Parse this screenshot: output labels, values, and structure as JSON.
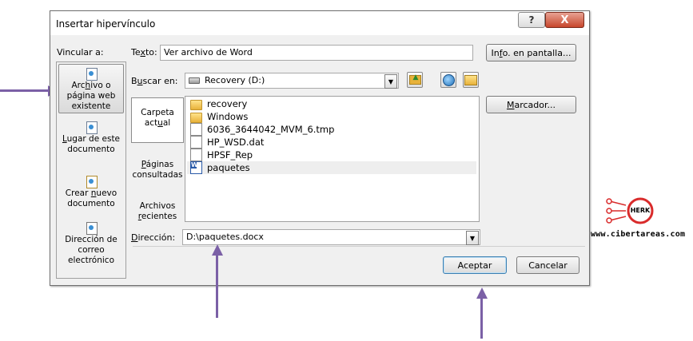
{
  "dialog": {
    "title": "Insertar hipervínculo",
    "help_label": "?",
    "close_label": "X",
    "link_to_label": "Vincular a:",
    "text_label_prefix": "Te",
    "text_label_key": "x",
    "text_label_suffix": "to:",
    "text_value": "Ver archivo de Word",
    "screen_tip_button_key": "f",
    "screen_tip_button_prefix": "In",
    "screen_tip_button_suffix": "o. en pantalla...",
    "look_in_label_prefix": "B",
    "look_in_label_key": "u",
    "look_in_label_suffix": "scar en:",
    "look_in_value": "Recovery (D:)",
    "bookmark_button_prefix": "",
    "bookmark_button_key": "M",
    "bookmark_button_suffix": "arcador...",
    "address_label_prefix": "",
    "address_label_key": "D",
    "address_label_suffix": "irección:",
    "address_value": "D:\\paquetes.docx",
    "ok_label": "Aceptar",
    "cancel_label": "Cancelar"
  },
  "link_to": [
    {
      "line1_pre": "Arc",
      "key": "h",
      "line1_post": "ivo o",
      "line2": "página web",
      "line3": "existente",
      "icon": "existing-file-icon"
    },
    {
      "line1_pre": "",
      "key": "L",
      "line1_post": "ugar de este",
      "line2": "documento",
      "line3": "",
      "icon": "place-in-document-icon"
    },
    {
      "line1_pre": "Crear ",
      "key": "n",
      "line1_post": "uevo",
      "line2": "documento",
      "line3": "",
      "icon": "new-document-icon"
    },
    {
      "line1_pre": "Dirección de",
      "key": "",
      "line1_post": "",
      "line2": "correo",
      "line3": "electrónico",
      "icon": "email-icon"
    }
  ],
  "subtabs": [
    {
      "line1": "Carpeta",
      "line2_pre": "act",
      "key": "u",
      "line2_post": "al"
    },
    {
      "line1_pre": "",
      "key": "P",
      "line1_post": "áginas",
      "line2": "consultadas"
    },
    {
      "line1": "Archivos",
      "line2_pre": "",
      "key": "r",
      "line2_post": "ecientes"
    }
  ],
  "files": [
    {
      "name": "recovery",
      "type": "folder"
    },
    {
      "name": "Windows",
      "type": "folder"
    },
    {
      "name": "6036_3644042_MVM_6.tmp",
      "type": "file"
    },
    {
      "name": "HP_WSD.dat",
      "type": "file"
    },
    {
      "name": "HPSF_Rep",
      "type": "file"
    },
    {
      "name": "paquetes",
      "type": "word",
      "selected": true
    }
  ],
  "watermark": {
    "logo_text": "HERK",
    "site": "www.cibertareas.com"
  },
  "colors": {
    "arrow": "#7b60a6",
    "close_button": "#c7462c",
    "default_button_border": "#3c7fb1"
  }
}
